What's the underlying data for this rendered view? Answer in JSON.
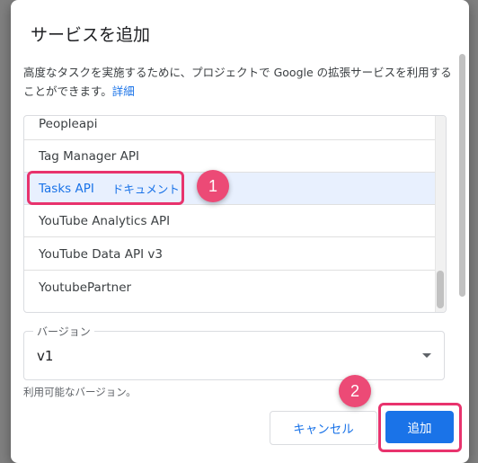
{
  "dialog": {
    "title": "サービスを追加",
    "description": "高度なタスクを実施するために、プロジェクトで Google の拡張サービスを利用することができます。",
    "details_link": "詳細"
  },
  "services": [
    {
      "name": "Peopleapi",
      "doc": ""
    },
    {
      "name": "Tag Manager API",
      "doc": ""
    },
    {
      "name": "Tasks API",
      "doc": "ドキュメント",
      "selected": true
    },
    {
      "name": "YouTube Analytics API",
      "doc": ""
    },
    {
      "name": "YouTube Data API v3",
      "doc": ""
    },
    {
      "name": "YoutubePartner",
      "doc": ""
    }
  ],
  "version": {
    "label": "バージョン",
    "value": "v1",
    "helper": "利用可能なバージョン。"
  },
  "buttons": {
    "cancel": "キャンセル",
    "add": "追加"
  },
  "annotations": {
    "badge1": "1",
    "badge2": "2",
    "color": "#e8336d"
  }
}
